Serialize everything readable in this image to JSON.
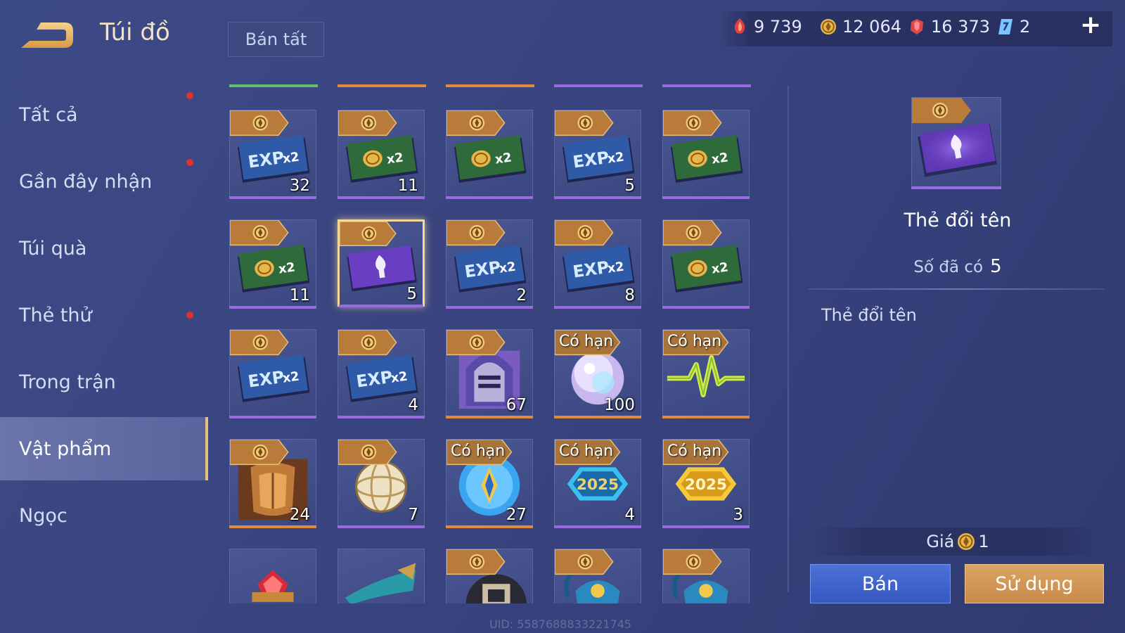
{
  "header": {
    "title": "Túi đồ",
    "sell_all_label": "Bán tất"
  },
  "currencies": [
    {
      "icon": "red-gem-icon",
      "value": "9 739",
      "color": "#e0403a"
    },
    {
      "icon": "gold-coin-icon",
      "value": "12 064",
      "color": "#e8b74a"
    },
    {
      "icon": "ruby-icon",
      "value": "16 373",
      "color": "#e0474a"
    },
    {
      "icon": "blue-voucher-icon",
      "value": "2",
      "color": "#7ec4ff"
    }
  ],
  "sidebar": {
    "items": [
      {
        "label": "Tất cả",
        "notify": true,
        "active": false
      },
      {
        "label": "Gần đây nhận",
        "notify": true,
        "active": false
      },
      {
        "label": "Túi quà",
        "notify": false,
        "active": false
      },
      {
        "label": "Thẻ thử",
        "notify": true,
        "active": false
      },
      {
        "label": "Trong trận",
        "notify": false,
        "active": false
      },
      {
        "label": "Vật phẩm",
        "notify": false,
        "active": true
      },
      {
        "label": "Ngọc",
        "notify": false,
        "active": false
      }
    ]
  },
  "grid": {
    "header_colors": [
      "#5fc06a",
      "#e08a3a",
      "#e08a3a",
      "#9a6ae0",
      "#9a6ae0"
    ],
    "limited_label": "Có hạn",
    "items": [
      {
        "icon": "exp-x2-card-icon",
        "count": "32",
        "tag": "coin",
        "rarity": "#9a6ae0"
      },
      {
        "icon": "gold-x2-card-icon",
        "count": "11",
        "tag": "coin",
        "rarity": "#9a6ae0"
      },
      {
        "icon": "gold-x2-card-icon",
        "count": "",
        "tag": "coin",
        "rarity": "#9a6ae0"
      },
      {
        "icon": "exp-x2-card-icon",
        "count": "5",
        "tag": "coin",
        "rarity": "#9a6ae0"
      },
      {
        "icon": "gold-x2-card-icon",
        "count": "",
        "tag": "coin",
        "rarity": "#9a6ae0"
      },
      {
        "icon": "gold-x2-card-icon",
        "count": "11",
        "tag": "coin",
        "rarity": "#9a6ae0"
      },
      {
        "icon": "rename-card-icon",
        "count": "5",
        "tag": "coin",
        "rarity": "#9a6ae0",
        "selected": true
      },
      {
        "icon": "exp-x2-card-icon",
        "count": "2",
        "tag": "coin",
        "rarity": "#9a6ae0"
      },
      {
        "icon": "exp-x2-card-icon",
        "count": "8",
        "tag": "coin",
        "rarity": "#9a6ae0"
      },
      {
        "icon": "gold-x2-card-icon",
        "count": "",
        "tag": "coin",
        "rarity": "#9a6ae0"
      },
      {
        "icon": "exp-x2-card-icon",
        "count": "",
        "tag": "coin",
        "rarity": "#9a6ae0"
      },
      {
        "icon": "exp-x2-card-icon",
        "count": "4",
        "tag": "coin",
        "rarity": "#9a6ae0"
      },
      {
        "icon": "helmet-icon",
        "count": "67",
        "tag": "coin",
        "rarity": "#e08a3a"
      },
      {
        "icon": "orb-icon",
        "count": "100",
        "tag": "limited",
        "rarity": "#e08a3a"
      },
      {
        "icon": "pulse-icon",
        "count": "",
        "tag": "limited",
        "rarity": "#e08a3a"
      },
      {
        "icon": "armor-icon",
        "count": "24",
        "tag": "coin",
        "rarity": "#e08a3a"
      },
      {
        "icon": "globe-icon",
        "count": "7",
        "tag": "coin",
        "rarity": "#9a6ae0"
      },
      {
        "icon": "blue-crystal-icon",
        "count": "27",
        "tag": "limited",
        "rarity": "#e08a3a"
      },
      {
        "icon": "badge-2025-blue-icon",
        "count": "4",
        "tag": "limited",
        "rarity": "#9a6ae0"
      },
      {
        "icon": "badge-2025-gold-icon",
        "count": "3",
        "tag": "limited",
        "rarity": "#9a6ae0"
      },
      {
        "icon": "red-gem-item-icon",
        "count": "",
        "tag": "none",
        "rarity": "#9a6ae0"
      },
      {
        "icon": "scroll-icon",
        "count": "",
        "tag": "none",
        "rarity": "#9a6ae0"
      },
      {
        "icon": "dark-emblem-icon",
        "count": "",
        "tag": "coin",
        "rarity": "#9a6ae0"
      },
      {
        "icon": "blue-chest-icon",
        "count": "",
        "tag": "coin",
        "rarity": "#9a6ae0"
      },
      {
        "icon": "blue-chest-icon",
        "count": "",
        "tag": "coin",
        "rarity": "#9a6ae0"
      }
    ]
  },
  "detail": {
    "icon": "rename-card-icon",
    "name": "Thẻ đổi tên",
    "owned_label": "Số đã có",
    "owned_value": "5",
    "description": "Thẻ đổi tên",
    "price_label": "Giá",
    "price_value": "1",
    "sell_label": "Bán",
    "use_label": "Sử dụng"
  },
  "footer": {
    "uid": "UID: 5587688833221745"
  }
}
